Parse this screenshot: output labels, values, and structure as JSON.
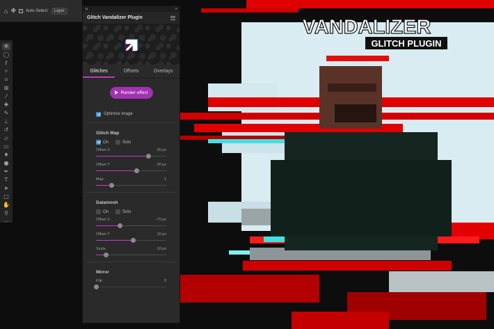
{
  "options_bar": {
    "auto_select_label": "Auto-Select:",
    "layer_value": "Layer"
  },
  "panel": {
    "title": "Glitch Vandalizer Plugin",
    "tabs": [
      {
        "label": "Glitches"
      },
      {
        "label": "Offsets"
      },
      {
        "label": "Overlays"
      }
    ],
    "render_label": "Render effect",
    "optimize_label": "Optimize image",
    "glitch_map": {
      "title": "Glitch Map",
      "on_label": "On",
      "solo_label": "Solo",
      "params": [
        {
          "label": "Offset X",
          "value_text": "30 px",
          "position": 0.75
        },
        {
          "label": "Offset Y",
          "value_text": "30 px",
          "position": 0.58
        },
        {
          "label": "Map",
          "value_text": "1",
          "position": 0.22
        }
      ]
    },
    "datamosh": {
      "title": "Datamosh",
      "on_label": "On",
      "solo_label": "Solo",
      "params": [
        {
          "label": "Offset X",
          "value_text": "-70 px",
          "position": 0.34
        },
        {
          "label": "Offset Y",
          "value_text": "10 px",
          "position": 0.53
        },
        {
          "label": "Scale",
          "value_text": "10 px",
          "position": 0.14
        }
      ]
    },
    "mirror": {
      "title": "Mirror",
      "params": [
        {
          "label": "Flip",
          "value_text": "0",
          "position": 0.0
        }
      ]
    }
  },
  "artwork": {
    "title": "VANDALIZER",
    "subtitle": "GLITCH PLUGIN"
  },
  "colors": {
    "accent": "#c23bc0",
    "button": "#a330b5",
    "glitch_red": "#e00000",
    "glitch_cyan": "#3fe0e4"
  }
}
